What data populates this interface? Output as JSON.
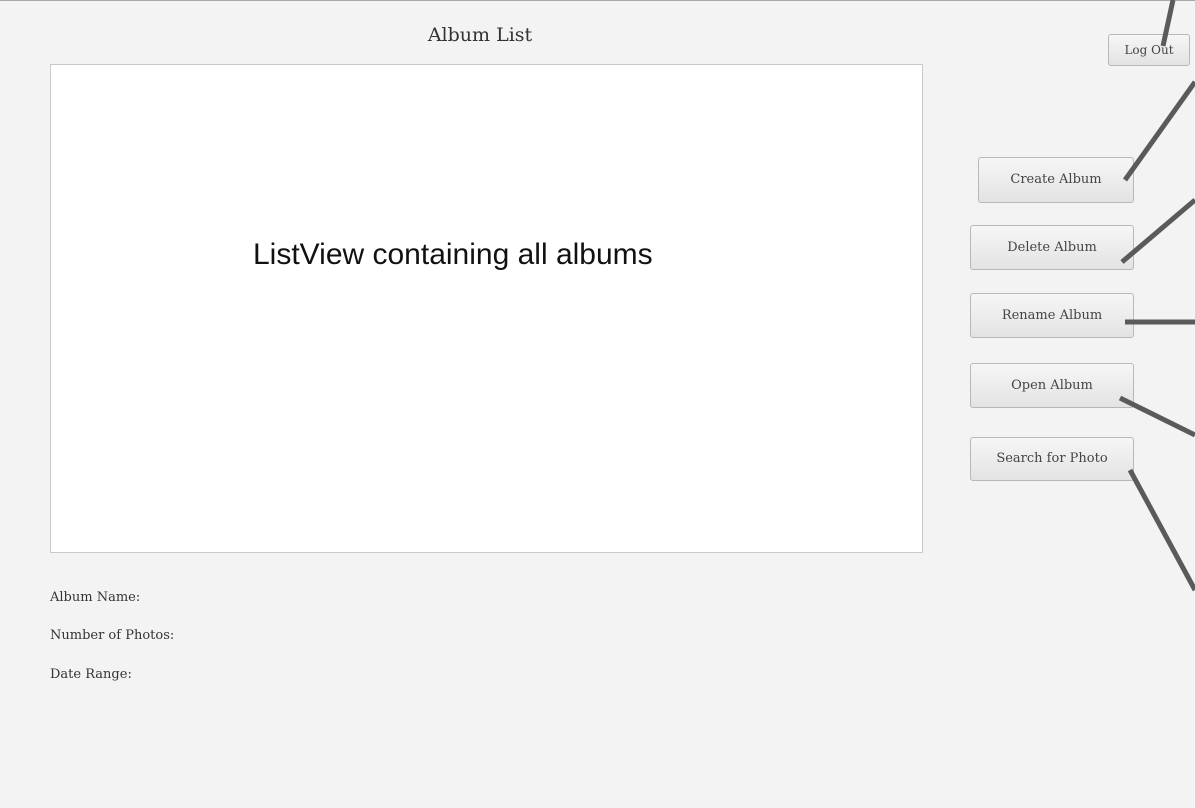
{
  "window": {
    "title": "Album List"
  },
  "album_list": {
    "annotation": "ListView containing all albums"
  },
  "buttons": {
    "logout": "Log Out",
    "create": "Create Album",
    "delete": "Delete Album",
    "rename": "Rename Album",
    "open": "Open Album",
    "search": "Search for Photo"
  },
  "details": {
    "album_name_label": "Album Name:",
    "photo_count_label": "Number of Photos:",
    "date_range_label": "Date Range:"
  },
  "colors": {
    "background": "#f3f3f3",
    "list_background": "#ffffff",
    "annotation_line": "#5a5a5a"
  }
}
